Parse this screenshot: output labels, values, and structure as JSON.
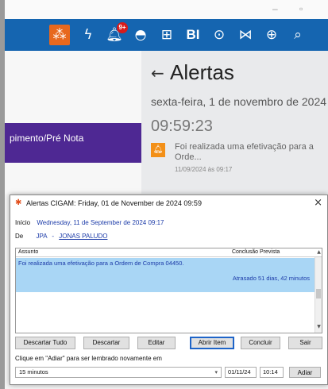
{
  "window": {
    "minimize": "–",
    "restore": "▫"
  },
  "toolbar": {
    "icons": [
      {
        "name": "workspace-icon",
        "glyph": "⁂"
      },
      {
        "name": "lightning-icon",
        "glyph": "ϟ"
      },
      {
        "name": "notifications-icon",
        "glyph": "🔔︎",
        "badge": "9+"
      },
      {
        "name": "user-alert-icon",
        "glyph": "◓"
      },
      {
        "name": "grid-icon",
        "glyph": "⊞"
      },
      {
        "name": "bi-icon",
        "glyph": "BI"
      },
      {
        "name": "play-icon",
        "glyph": "⊙"
      },
      {
        "name": "chart-icon",
        "glyph": "⋈"
      },
      {
        "name": "globe-icon",
        "glyph": "⊕"
      },
      {
        "name": "search-icon",
        "glyph": "⌕"
      }
    ],
    "accent_color": "#1565b0",
    "orange_color": "#e7681e"
  },
  "left_panel": {
    "menu_item": "pimento/Pré Nota",
    "menu_color": "#4e2893"
  },
  "alerts_panel": {
    "back": "←",
    "title": "Alertas",
    "date": "sexta-feira, 1 de novembro de 2024",
    "time": "09:59:23",
    "item_message": "Foi realizada uma efetivação para a Orde...",
    "item_time": "11/09/2024 às 09:17",
    "bell_color": "#f39018"
  },
  "dialog": {
    "title": "Alertas CIGAM: Friday, 01 de November de 2024 09:59",
    "close": "×",
    "inicio_label": "Início",
    "inicio_value": "Wednesday, 11 de September de 2024 09:17",
    "de_label": "De",
    "de_code": "JPA",
    "de_separator": "-",
    "de_name": "JONAS PALUDO",
    "grid": {
      "col_subject": "Assunto",
      "col_conclusion": "Conclusão Prevista",
      "row_subject": "Foi realizada uma efetivação para a Ordem de Compra 04450.",
      "row_status": "Atrasado 51 dias, 42 minutos",
      "scroll_up": "▲",
      "scroll_down": "▼"
    },
    "buttons": {
      "descartar_tudo": "Descartar Tudo",
      "descartar": "Descartar",
      "editar": "Editar",
      "abrir_item": "Abrir Item",
      "concluir": "Concluir",
      "sair": "Sair"
    },
    "hint": "Clique em \"Adiar\" para ser lembrado novamente em",
    "snooze_select": "15 minutos",
    "snooze_date": "01/11/24",
    "snooze_time": "10:14",
    "adiar": "Adiar",
    "dropdown_arrow": "▾"
  }
}
